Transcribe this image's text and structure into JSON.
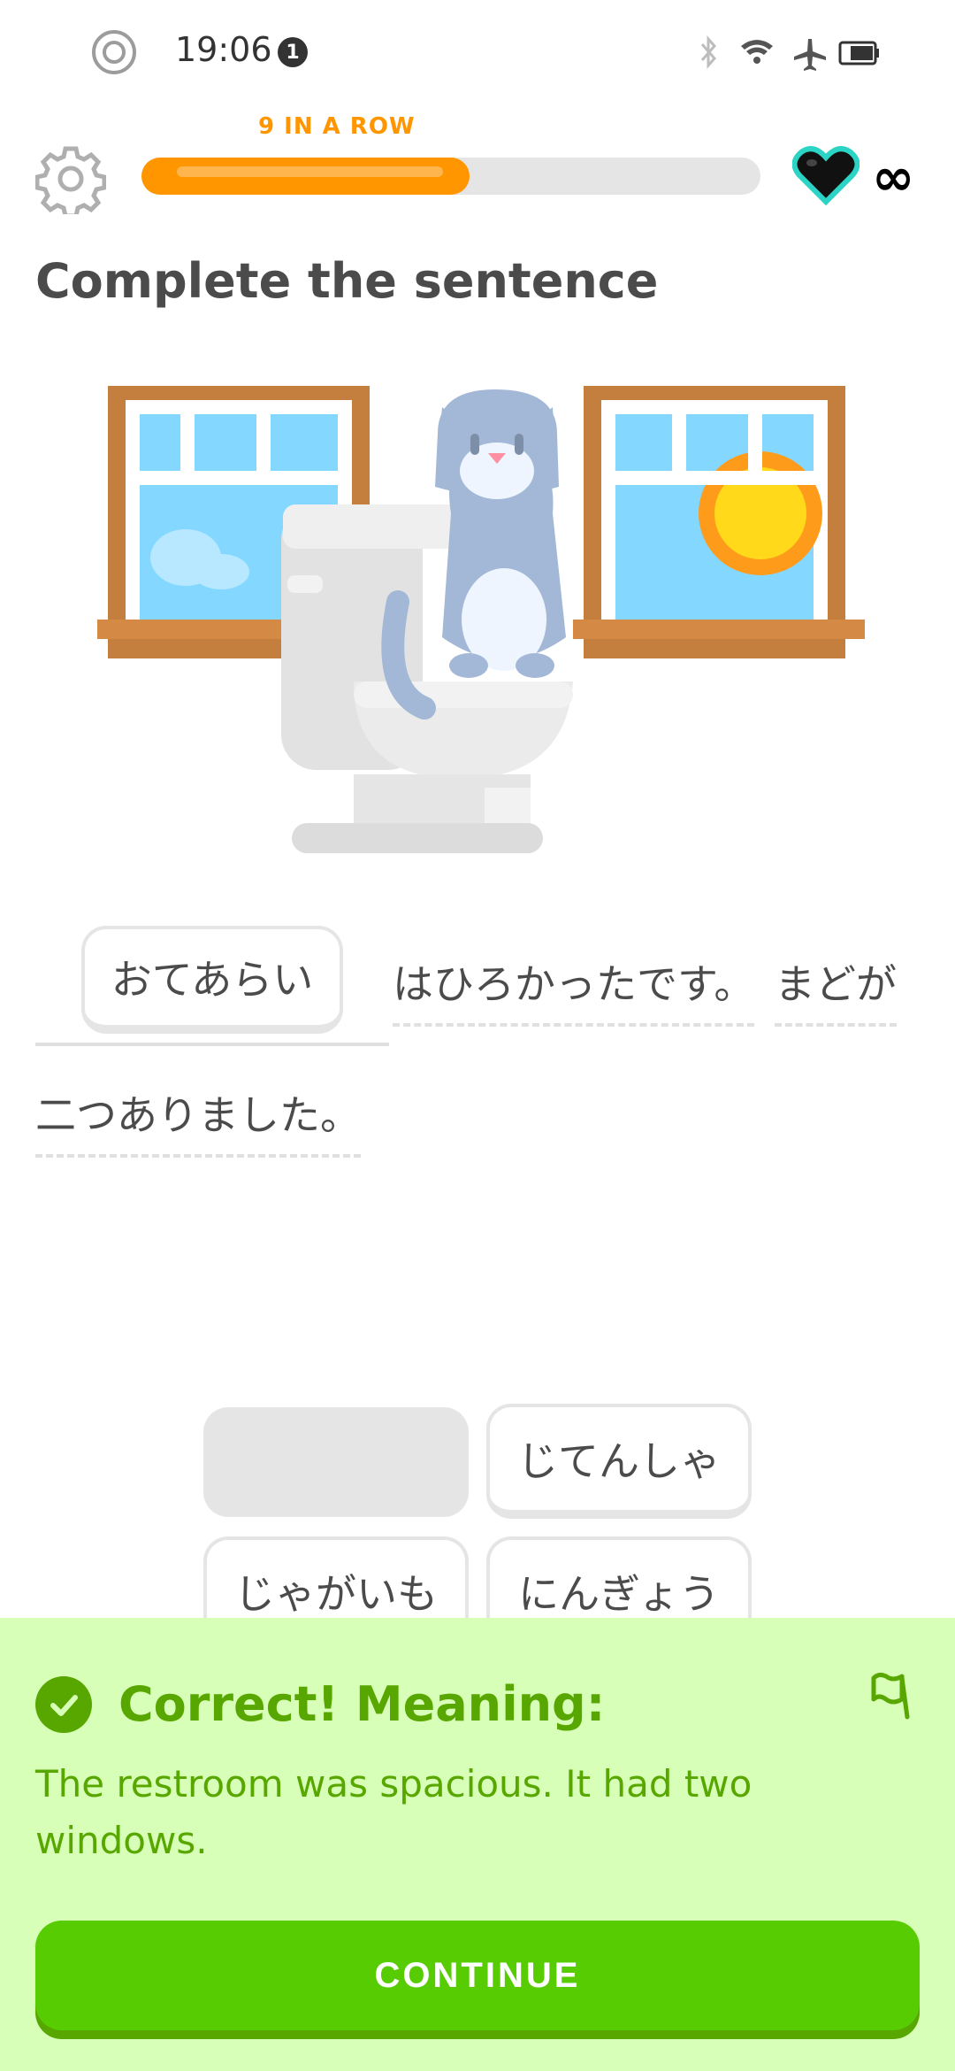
{
  "status_bar": {
    "time": "19:06",
    "notification_count": "1"
  },
  "header": {
    "streak": "9 IN A ROW",
    "progress": 0.53,
    "hearts": "∞"
  },
  "prompt": {
    "title": "Complete the sentence"
  },
  "sentence": {
    "filled_word": "おてあらい",
    "segments": [
      "はひろかったです。",
      "まどが",
      "二つありました。"
    ]
  },
  "word_bank": {
    "words": [
      "じてんしゃ",
      "じゃがいも",
      "にんぎょう"
    ]
  },
  "feedback": {
    "title": "Correct! Meaning:",
    "translation": "The restroom was spacious. It had two windows.",
    "continue_label": "CONTINUE"
  },
  "colors": {
    "accent_orange": "#ff9600",
    "success_green": "#58a700",
    "button_green": "#58cc02",
    "panel_green": "#d7ffb8"
  }
}
